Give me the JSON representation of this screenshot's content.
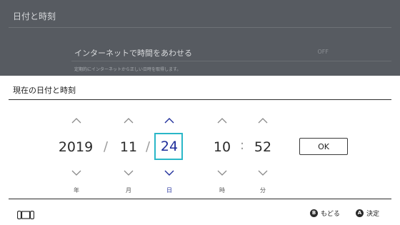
{
  "background": {
    "title": "日付と時刻",
    "setting_label": "インターネットで時間をあわせる",
    "setting_value": "OFF",
    "setting_description": "定期的にインターネットから正しい日時を取得します。"
  },
  "dialog": {
    "title": "現在の日付と時刻",
    "fields": {
      "year": {
        "value": "2019",
        "unit": "年"
      },
      "month": {
        "value": "11",
        "unit": "月"
      },
      "day": {
        "value": "24",
        "unit": "日"
      },
      "hour": {
        "value": "10",
        "unit": "時"
      },
      "minute": {
        "value": "52",
        "unit": "分"
      }
    },
    "date_separator": "/",
    "time_separator": ":",
    "ok_label": "OK"
  },
  "footer": {
    "back": {
      "key": "B",
      "label": "もどる"
    },
    "confirm": {
      "key": "A",
      "label": "決定"
    }
  },
  "colors": {
    "selection_border": "#2ab7c8",
    "selected_text": "#1f2e9b",
    "dim_overlay": "#575b61"
  }
}
